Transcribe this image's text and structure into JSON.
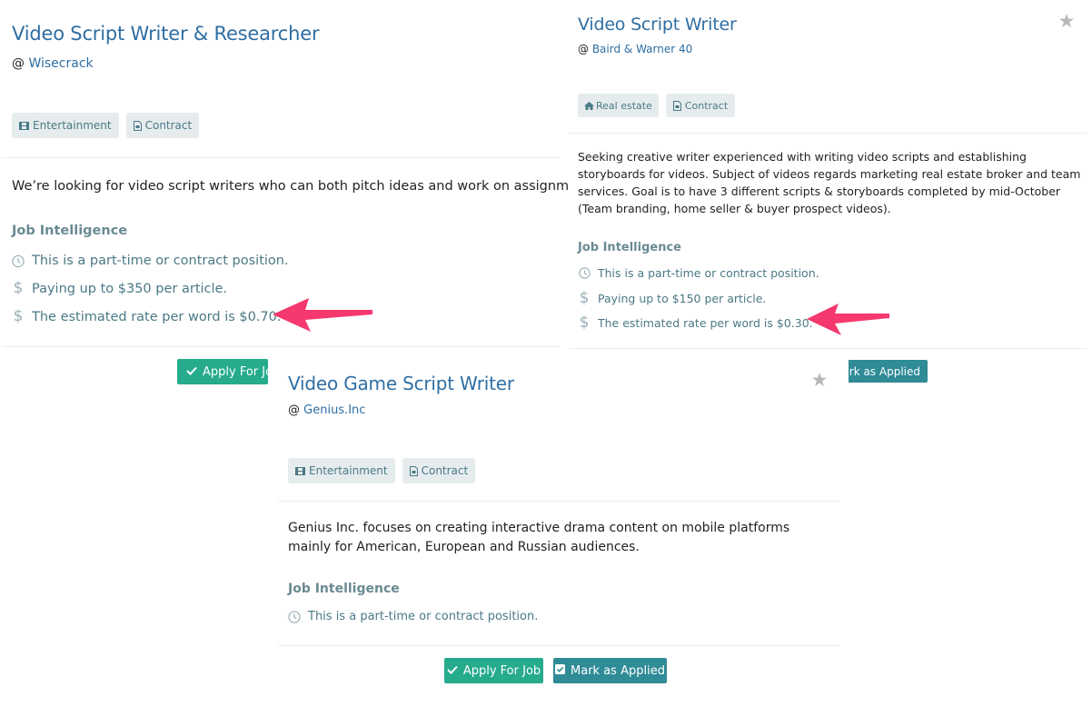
{
  "cards": [
    {
      "title": "Video Script Writer & Researcher",
      "company_prefix": "@",
      "company": "Wisecrack",
      "tags": [
        {
          "icon": "film-icon",
          "label": "Entertainment"
        },
        {
          "icon": "document-icon",
          "label": "Contract"
        }
      ],
      "description": "We’re looking for video script writers who can both pitch ideas and work on assignments.",
      "job_intelligence_title": "Job Intelligence",
      "intel": [
        {
          "icon": "clock-icon",
          "text": "This is a part-time or contract position."
        },
        {
          "icon": "dollar-icon",
          "text": "Paying up to $350 per article."
        },
        {
          "icon": "dollar-icon",
          "text": "The estimated rate per word is $0.70."
        }
      ],
      "apply_label": "Apply For Job",
      "apply_label_visible": "Apply For Jo"
    },
    {
      "title": "Video Script Writer",
      "company_prefix": "@",
      "company": "Baird & Warner 40",
      "tags": [
        {
          "icon": "home-icon",
          "label": "Real estate"
        },
        {
          "icon": "document-icon",
          "label": "Contract"
        }
      ],
      "description": "Seeking creative writer experienced with writing video scripts and establishing storyboards for videos. Subject of videos regards marketing real estate broker and team services. Goal is to have 3 different scripts & storyboards completed by mid-October (Team branding, home seller & buyer prospect videos).",
      "job_intelligence_title": "Job Intelligence",
      "intel": [
        {
          "icon": "clock-icon",
          "text": "This is a part-time or contract position."
        },
        {
          "icon": "dollar-icon",
          "text": "Paying up to $150 per article."
        },
        {
          "icon": "dollar-icon",
          "text": "The estimated rate per word is $0.30."
        }
      ],
      "mark_label_visible": "ark as Applied"
    },
    {
      "title": "Video Game Script Writer",
      "company_prefix": "@",
      "company": "Genius.Inc",
      "tags": [
        {
          "icon": "film-icon",
          "label": "Entertainment"
        },
        {
          "icon": "document-icon",
          "label": "Contract"
        }
      ],
      "description": "Genius Inc. focuses on creating interactive drama content on mobile platforms mainly for American, European and Russian audiences.",
      "job_intelligence_title": "Job Intelligence",
      "intel": [
        {
          "icon": "clock-icon",
          "text": "This is a part-time or contract position."
        }
      ],
      "apply_label": "Apply For Job",
      "mark_label": "Mark as Applied"
    }
  ],
  "colors": {
    "title_blue": "#2f6ea3",
    "apply_green": "#26ab8d",
    "mark_teal": "#2f8b96",
    "annotation_arrow": "#f5386e",
    "star_gray": "#b7b7b7"
  }
}
